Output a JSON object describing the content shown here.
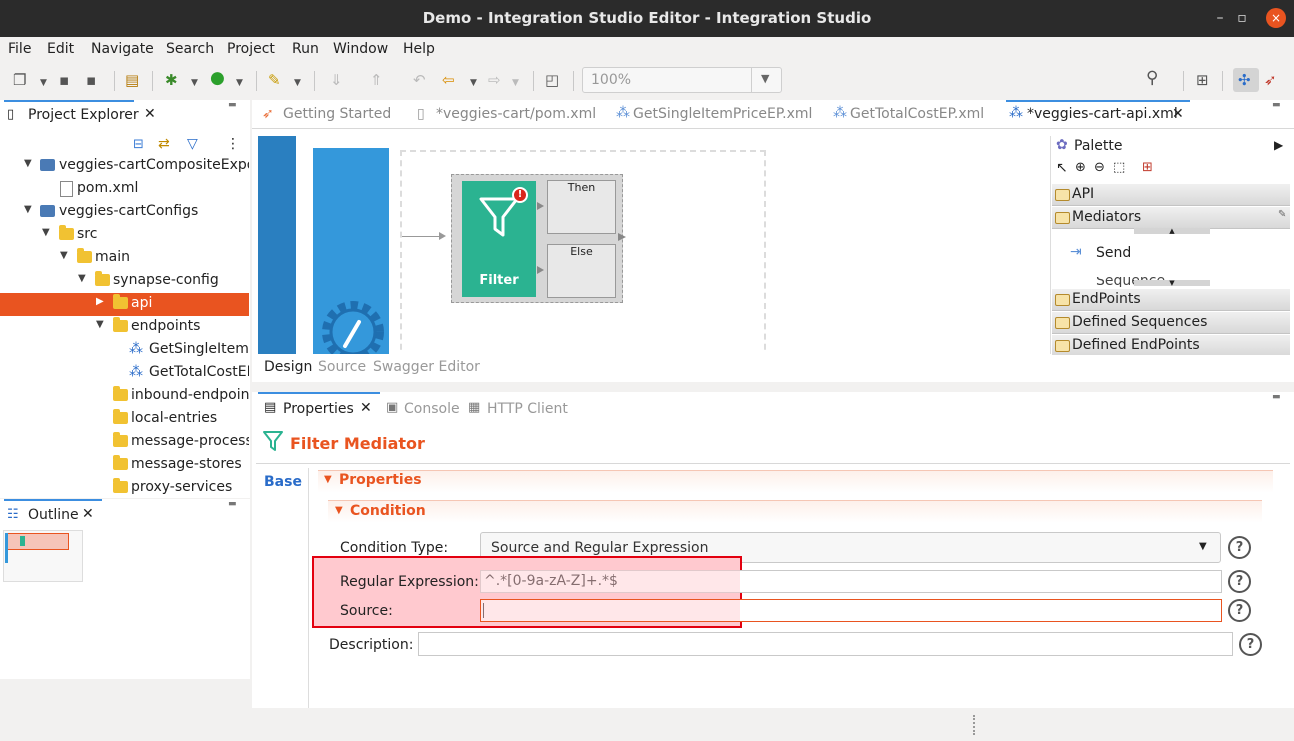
{
  "window": {
    "title": "Demo - Integration Studio Editor - Integration Studio",
    "btn_min": "–",
    "btn_max": "▫",
    "btn_close": "×"
  },
  "menu": [
    "File",
    "Edit",
    "Navigate",
    "Search",
    "Project",
    "Run",
    "Window",
    "Help"
  ],
  "toolbar": {
    "zoom": "100%"
  },
  "project_explorer": {
    "title": "Project Explorer",
    "items": [
      {
        "label": "veggies-cartCompositeExporter"
      },
      {
        "label": "pom.xml"
      },
      {
        "label": "veggies-cartConfigs"
      },
      {
        "label": "src"
      },
      {
        "label": "main"
      },
      {
        "label": "synapse-config"
      },
      {
        "label": "api"
      },
      {
        "label": "endpoints"
      },
      {
        "label": "GetSingleItemPriceEP"
      },
      {
        "label": "GetTotalCostEP"
      },
      {
        "label": "inbound-endpoints"
      },
      {
        "label": "local-entries"
      },
      {
        "label": "message-processors"
      },
      {
        "label": "message-stores"
      },
      {
        "label": "proxy-services"
      }
    ]
  },
  "outline": {
    "title": "Outline"
  },
  "editor_tabs": [
    {
      "label": "Getting Started"
    },
    {
      "label": "*veggies-cart/pom.xml"
    },
    {
      "label": "GetSingleItemPriceEP.xml"
    },
    {
      "label": "GetTotalCostEP.xml"
    },
    {
      "label": "*veggies-cart-api.xml"
    }
  ],
  "canvas": {
    "filter_label": "Filter",
    "then_label": "Then",
    "else_label": "Else"
  },
  "design_tabs": [
    "Design",
    "Source",
    "Swagger Editor"
  ],
  "palette": {
    "title": "Palette",
    "sections": [
      "API",
      "Mediators",
      "EndPoints",
      "Defined Sequences",
      "Defined EndPoints"
    ],
    "items": [
      "Send",
      "Sequence"
    ]
  },
  "bottom_tabs": [
    "Properties",
    "Console",
    "HTTP Client"
  ],
  "properties": {
    "heading": "Filter Mediator",
    "side_tab": "Base",
    "section": "Properties",
    "subsection": "Condition",
    "condition_type_label": "Condition Type:",
    "condition_type_value": "Source and Regular Expression",
    "regex_label": "Regular Expression:",
    "regex_value": "^.*[0-9a-zA-Z]+.*$",
    "source_label": "Source:",
    "source_value": "",
    "description_label": "Description:",
    "description_value": "",
    "help": "?"
  },
  "colors": {
    "selection": "#e95420",
    "filter": "#2bb391",
    "highlight": "#ff0000",
    "sequence_blue": "#3498db"
  }
}
